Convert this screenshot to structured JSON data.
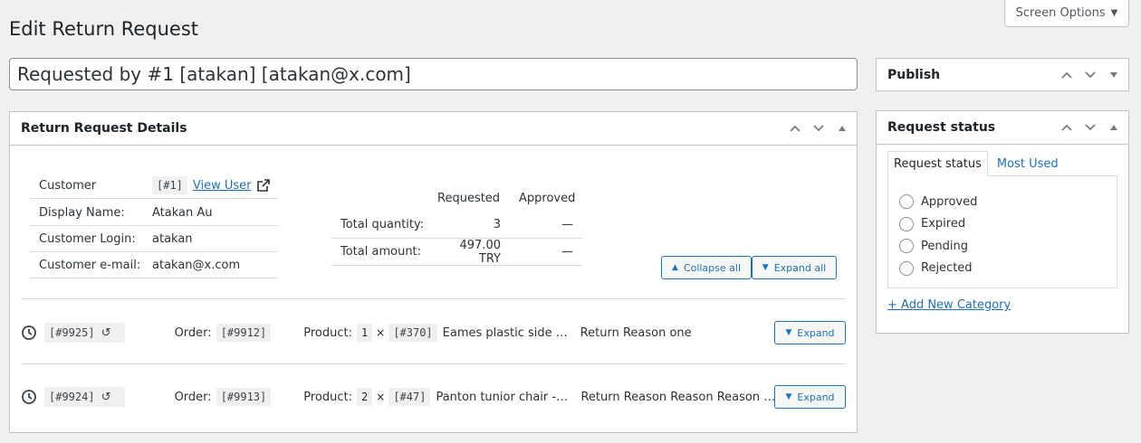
{
  "screen_options": {
    "label": "Screen Options"
  },
  "page_title": "Edit Return Request",
  "title_value": "Requested by #1 [atakan] [atakan@x.com]",
  "details": {
    "heading": "Return Request Details",
    "customer": {
      "customer_label": "Customer",
      "customer_id": "[#1]",
      "view_user": "View User",
      "display_name_label": "Display Name:",
      "display_name": "Atakan Au",
      "login_label": "Customer Login:",
      "login": "atakan",
      "email_label": "Customer e-mail:",
      "email": "atakan@x.com"
    },
    "summary": {
      "col_requested": "Requested",
      "col_approved": "Approved",
      "rows": [
        {
          "label": "Total quantity:",
          "requested": "3",
          "approved": "—"
        },
        {
          "label": "Total amount:",
          "requested": "497.00 TRY",
          "approved": "—"
        }
      ]
    },
    "collapse_all": "Collapse all",
    "expand_all": "Expand all",
    "requests": [
      {
        "id": "[#9925]",
        "revert": "↺",
        "order_label": "Order:",
        "order": "[#9912]",
        "product_label": "Product:",
        "qty": "1",
        "times": "×",
        "product_id": "[#370]",
        "product_name": "Eames plastic side chair",
        "reason": "Return Reason one",
        "expand": "Expand"
      },
      {
        "id": "[#9924]",
        "revert": "↺",
        "order_label": "Order:",
        "order": "[#9913]",
        "product_label": "Product:",
        "qty": "2",
        "times": "×",
        "product_id": "[#47]",
        "product_name": "Panton tunior chair - white",
        "reason": "Return Reason Reason Reason Reason",
        "expand": "Expand"
      }
    ]
  },
  "publish": {
    "heading": "Publish"
  },
  "request_status": {
    "heading": "Request status",
    "tabs": [
      "Request status",
      "Most Used"
    ],
    "options": [
      "Approved",
      "Expired",
      "Pending",
      "Rejected"
    ],
    "add_new": "+ Add New Category"
  },
  "colors": {
    "accent": "#2271b1",
    "border": "#c3c4c7",
    "background": "#f0f0f1"
  }
}
